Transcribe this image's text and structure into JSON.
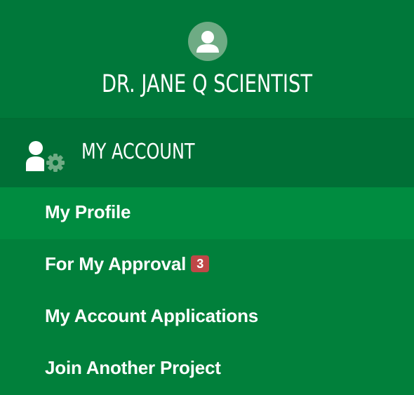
{
  "user": {
    "name": "DR. JANE Q SCIENTIST",
    "avatar_icon": "user-avatar-icon"
  },
  "section": {
    "label": "MY ACCOUNT",
    "icon": "user-settings-icon"
  },
  "menu": {
    "items": [
      {
        "label": "My Profile",
        "active": true,
        "badge": ""
      },
      {
        "label": "For My Approval",
        "active": false,
        "badge": "3"
      },
      {
        "label": "My Account Applications",
        "active": false,
        "badge": ""
      },
      {
        "label": "Join Another Project",
        "active": false,
        "badge": ""
      }
    ]
  },
  "colors": {
    "background": "#01803b",
    "header": "#00783a",
    "section_header": "#006f36",
    "active_item": "#008c40",
    "avatar_circle": "#6eab84",
    "badge": "#bf4747"
  }
}
